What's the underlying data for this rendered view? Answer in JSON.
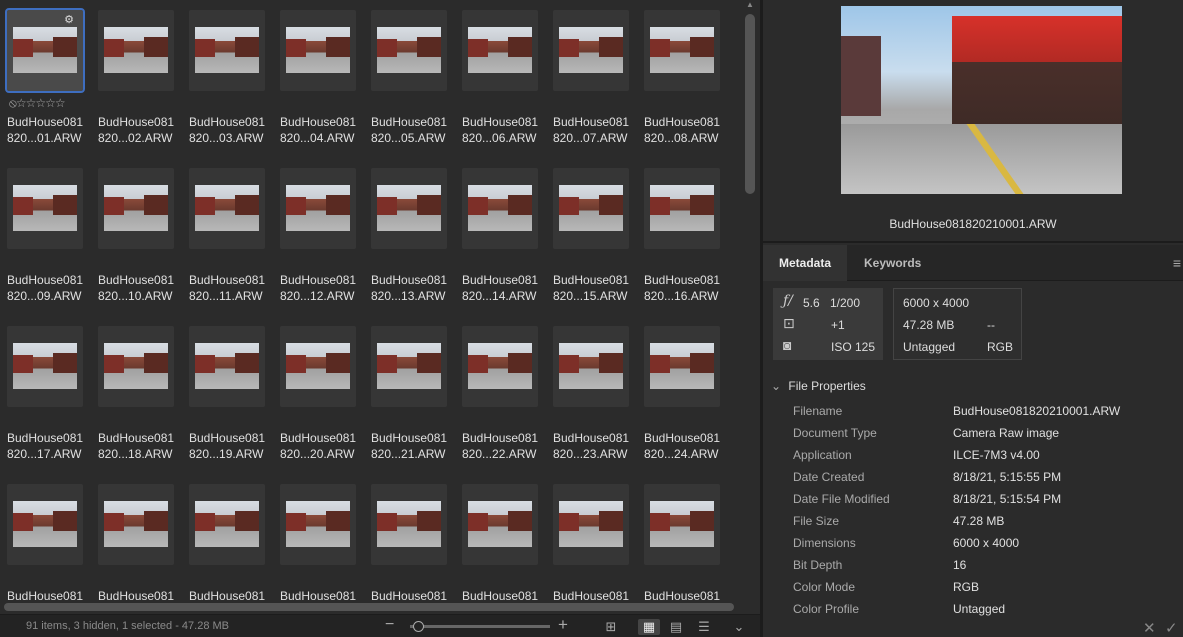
{
  "grid": {
    "items": [
      {
        "line1": "BudHouse081",
        "line2": "820...01.ARW",
        "selected": true
      },
      {
        "line1": "BudHouse081",
        "line2": "820...02.ARW"
      },
      {
        "line1": "BudHouse081",
        "line2": "820...03.ARW"
      },
      {
        "line1": "BudHouse081",
        "line2": "820...04.ARW"
      },
      {
        "line1": "BudHouse081",
        "line2": "820...05.ARW"
      },
      {
        "line1": "BudHouse081",
        "line2": "820...06.ARW"
      },
      {
        "line1": "BudHouse081",
        "line2": "820...07.ARW"
      },
      {
        "line1": "BudHouse081",
        "line2": "820...08.ARW"
      },
      {
        "line1": "BudHouse081",
        "line2": "820...09.ARW"
      },
      {
        "line1": "BudHouse081",
        "line2": "820...10.ARW"
      },
      {
        "line1": "BudHouse081",
        "line2": "820...11.ARW"
      },
      {
        "line1": "BudHouse081",
        "line2": "820...12.ARW"
      },
      {
        "line1": "BudHouse081",
        "line2": "820...13.ARW"
      },
      {
        "line1": "BudHouse081",
        "line2": "820...14.ARW"
      },
      {
        "line1": "BudHouse081",
        "line2": "820...15.ARW"
      },
      {
        "line1": "BudHouse081",
        "line2": "820...16.ARW"
      },
      {
        "line1": "BudHouse081",
        "line2": "820...17.ARW"
      },
      {
        "line1": "BudHouse081",
        "line2": "820...18.ARW"
      },
      {
        "line1": "BudHouse081",
        "line2": "820...19.ARW"
      },
      {
        "line1": "BudHouse081",
        "line2": "820...20.ARW"
      },
      {
        "line1": "BudHouse081",
        "line2": "820...21.ARW"
      },
      {
        "line1": "BudHouse081",
        "line2": "820...22.ARW"
      },
      {
        "line1": "BudHouse081",
        "line2": "820...23.ARW"
      },
      {
        "line1": "BudHouse081",
        "line2": "820...24.ARW"
      },
      {
        "line1": "BudHouse081",
        "line2": ""
      },
      {
        "line1": "BudHouse081",
        "line2": ""
      },
      {
        "line1": "BudHouse081",
        "line2": ""
      },
      {
        "line1": "BudHouse081",
        "line2": ""
      },
      {
        "line1": "BudHouse081",
        "line2": ""
      },
      {
        "line1": "BudHouse081",
        "line2": ""
      },
      {
        "line1": "BudHouse081",
        "line2": ""
      },
      {
        "line1": "BudHouse081",
        "line2": ""
      }
    ],
    "selected_rating": "⦸☆☆☆☆☆"
  },
  "status": {
    "text": "91 items, 3 hidden, 1 selected - 47.28 MB"
  },
  "preview": {
    "filename": "BudHouse081820210001.ARW"
  },
  "metadata": {
    "tabs": [
      "Metadata",
      "Keywords"
    ],
    "camera": {
      "aperture": "5.6",
      "shutter": "1/200",
      "exposure_comp": "+1",
      "iso": "ISO 125"
    },
    "file_summary": {
      "dimensions": "6000 x 4000",
      "size": "47.28 MB",
      "dash": "--",
      "label": "Untagged",
      "mode": "RGB"
    },
    "section_title": "File Properties",
    "properties": [
      {
        "key": "Filename",
        "value": "BudHouse081820210001.ARW"
      },
      {
        "key": "Document Type",
        "value": "Camera Raw image"
      },
      {
        "key": "Application",
        "value": "ILCE-7M3 v4.00"
      },
      {
        "key": "Date Created",
        "value": "8/18/21, 5:15:55 PM"
      },
      {
        "key": "Date File Modified",
        "value": "8/18/21, 5:15:54 PM"
      },
      {
        "key": "File Size",
        "value": "47.28 MB"
      },
      {
        "key": "Dimensions",
        "value": "6000 x 4000"
      },
      {
        "key": "Bit Depth",
        "value": "16"
      },
      {
        "key": "Color Mode",
        "value": "RGB"
      },
      {
        "key": "Color Profile",
        "value": "Untagged"
      }
    ]
  }
}
